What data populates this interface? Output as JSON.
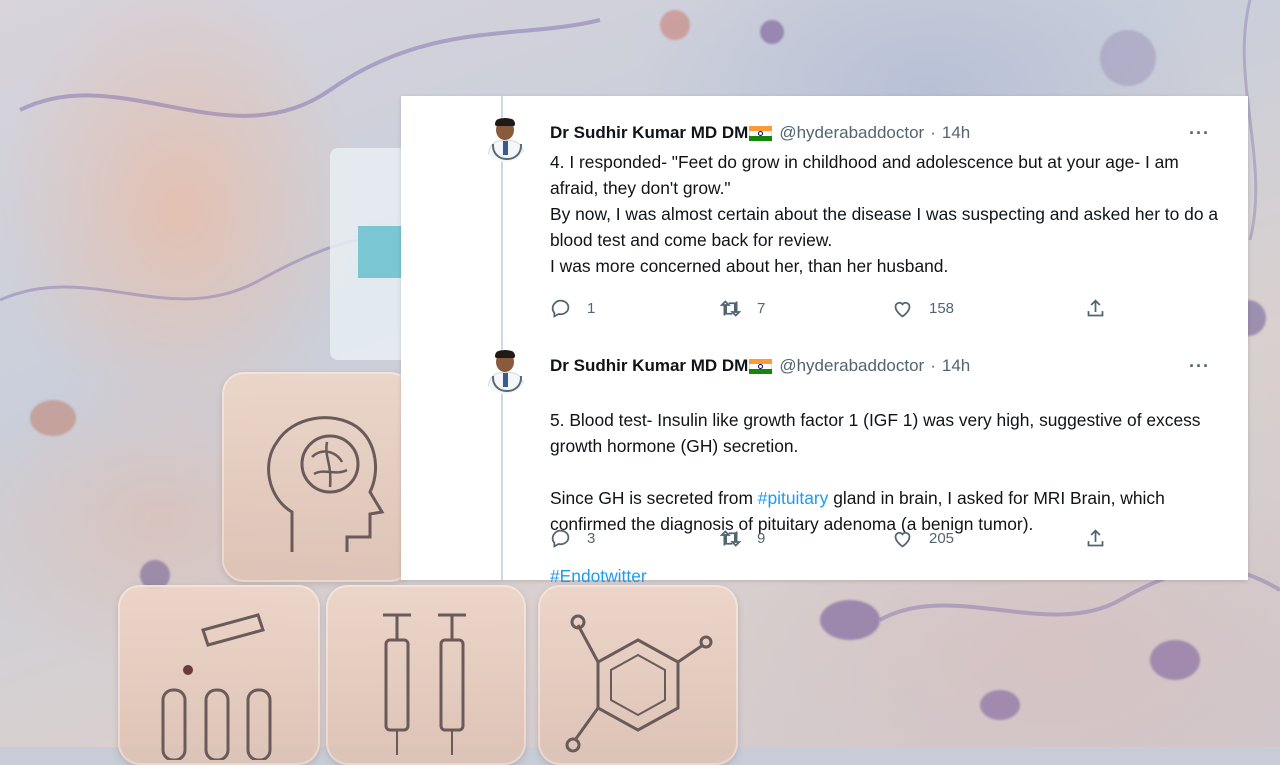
{
  "tweets": [
    {
      "author_name": "Dr Sudhir Kumar MD DM",
      "flag": "india-flag",
      "handle": "@hyderabaddoctor",
      "separator": "·",
      "time": "14h",
      "more": "···",
      "text_lines": [
        "4. I responded- \"Feet do grow in childhood and adolescence but at your age- I am afraid, they don't grow.\"",
        "By now, I was almost certain about the disease I was suspecting and asked her to do a blood test and come back for review.",
        "I was more concerned about her, than her husband."
      ],
      "replies": "1",
      "retweets": "7",
      "likes": "158"
    },
    {
      "author_name": "Dr Sudhir Kumar MD DM",
      "flag": "india-flag",
      "handle": "@hyderabaddoctor",
      "separator": "·",
      "time": "14h",
      "more": "···",
      "line1": "5. Blood test- Insulin like growth factor 1 (IGF 1) was very high, suggestive of excess growth hormone (GH) secretion.",
      "line2_prefix": "Since GH is secreted from ",
      "line2_hashtag": "#pituitary",
      "line2_suffix": " gland in brain, I asked for MRI Brain, which confirmed the diagnosis of pituitary adenoma (a benign tumor).",
      "hashtag": "#Endotwitter",
      "replies": "3",
      "retweets": "9",
      "likes": "205"
    }
  ],
  "colors": {
    "text": "#0f1419",
    "secondary": "#536471",
    "link": "#1d9bf0",
    "thread_line": "#cfd9de"
  },
  "icons": [
    "reply-icon",
    "retweet-icon",
    "like-icon",
    "share-icon",
    "more-icon",
    "brain-icon",
    "test-tubes-icon",
    "syringe-icon",
    "molecule-icon"
  ]
}
